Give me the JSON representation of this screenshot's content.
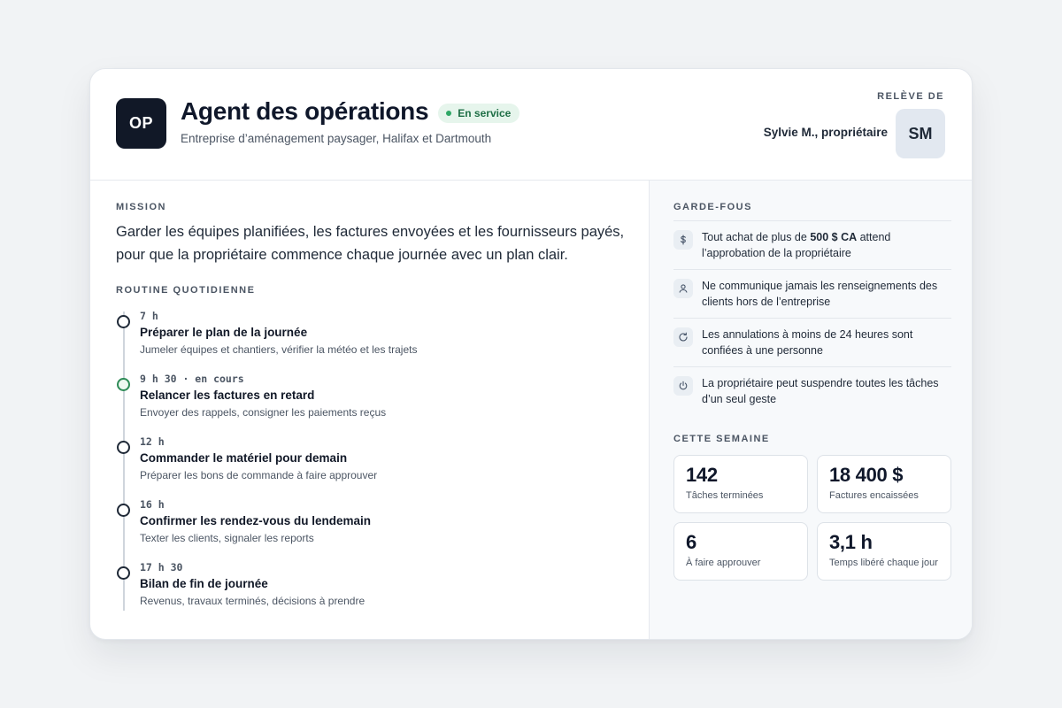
{
  "header": {
    "logo_text": "OP",
    "title": "Agent des opérations",
    "status_badge": "En service",
    "subtitle": "Entreprise d’aménagement paysager, Halifax et Dartmouth",
    "releve_label": "RELÈVE DE",
    "owner_name": "Sylvie M., propriétaire",
    "owner_initials": "SM"
  },
  "mission": {
    "label": "MISSION",
    "text": "Garder les équipes planifiées, les factures envoyées et les fournisseurs payés, pour que la propriétaire commence chaque journée avec un plan clair."
  },
  "routine": {
    "label": "ROUTINE QUOTIDIENNE",
    "steps": [
      {
        "time": "7 h",
        "title": "Préparer le plan de la journée",
        "desc": "Jumeler équipes et chantiers, vérifier la météo et les trajets",
        "active": false
      },
      {
        "time": "9 h 30 · en cours",
        "title": "Relancer les factures en retard",
        "desc": "Envoyer des rappels, consigner les paiements reçus",
        "active": true
      },
      {
        "time": "12 h",
        "title": "Commander le matériel pour demain",
        "desc": "Préparer les bons de commande à faire approuver",
        "active": false
      },
      {
        "time": "16 h",
        "title": "Confirmer les rendez-vous du lendemain",
        "desc": "Texter les clients, signaler les reports",
        "active": false
      },
      {
        "time": "17 h 30",
        "title": "Bilan de fin de journée",
        "desc": "Revenus, travaux terminés, décisions à prendre",
        "active": false
      }
    ]
  },
  "guardrails": {
    "label": "GARDE-FOUS",
    "items": [
      {
        "icon": "dollar-icon",
        "before": "Tout achat de plus de ",
        "bold": "500 $ CA",
        "after": " attend l’approbation de la propriétaire"
      },
      {
        "icon": "user-icon",
        "before": "Ne communique jamais les renseignements des clients hors de l’entreprise",
        "bold": "",
        "after": ""
      },
      {
        "icon": "refresh-icon",
        "before": "Les annulations à moins de 24 heures sont confiées à une personne",
        "bold": "",
        "after": ""
      },
      {
        "icon": "power-icon",
        "before": "La propriétaire peut suspendre toutes les tâches d’un seul geste",
        "bold": "",
        "after": ""
      }
    ]
  },
  "week": {
    "label": "CETTE SEMAINE",
    "stats": [
      {
        "value": "142",
        "label": "Tâches terminées"
      },
      {
        "value": "18 400 $",
        "label": "Factures encaissées"
      },
      {
        "value": "6",
        "label": "À faire approuver"
      },
      {
        "value": "3,1 h",
        "label": "Temps libéré chaque jour"
      }
    ]
  },
  "colors": {
    "accent_dark": "#111827",
    "status_green": "#2fa866",
    "badge_bg": "#e6f5ec"
  }
}
